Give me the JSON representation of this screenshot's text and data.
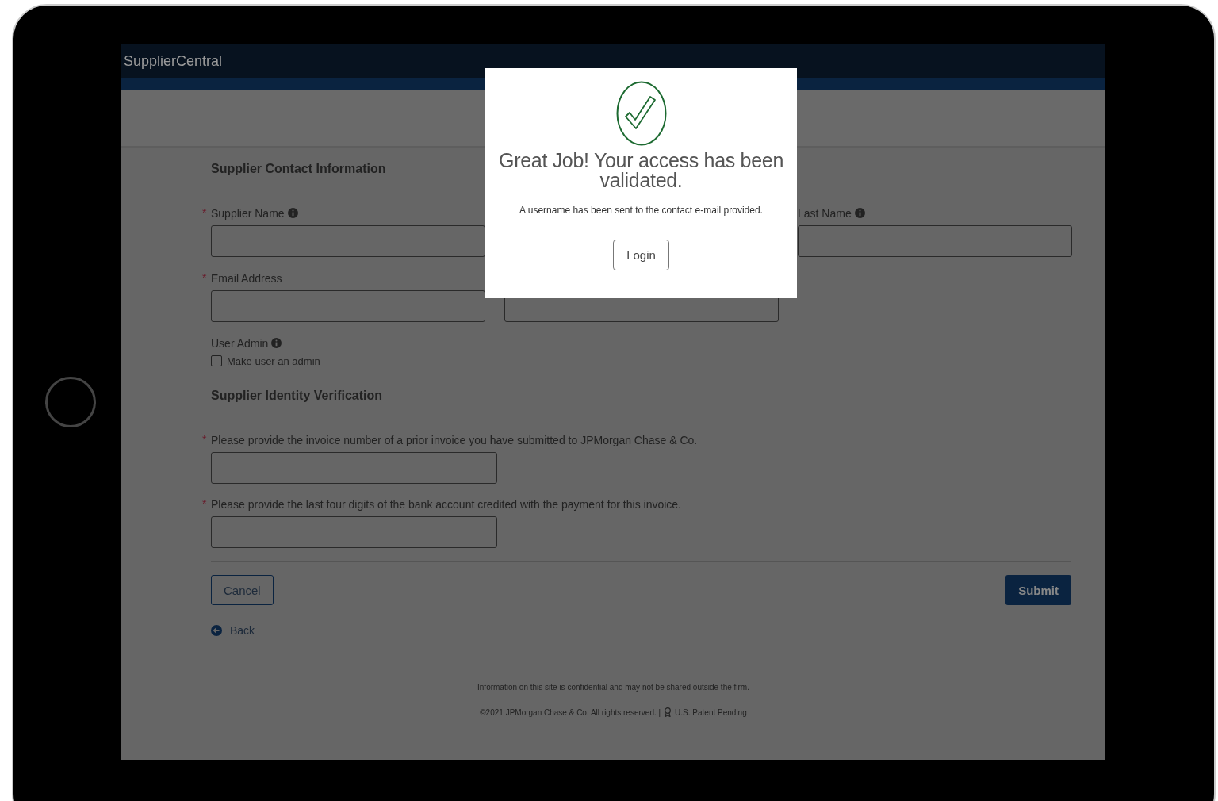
{
  "header": {
    "title": "SupplierCentral"
  },
  "contact_section": {
    "title": "Supplier Contact Information",
    "rows": [
      [
        {
          "kind": "labeled",
          "marker": "*",
          "label": "Supplier Name",
          "info": true
        },
        {
          "kind": "covered"
        },
        {
          "kind": "labeled",
          "label": "Last Name",
          "info": true
        }
      ],
      [
        {
          "kind": "labeled",
          "marker": "*",
          "label": "Email Address",
          "info": false
        },
        {
          "kind": "input"
        }
      ]
    ],
    "user_admin": {
      "label": "User Admin",
      "info": true,
      "checkbox_label": "Make user an admin",
      "checked": false
    }
  },
  "identity_section": {
    "title": "Supplier Identity Verification",
    "questions": [
      {
        "marker": "*",
        "label": "Please provide the invoice number of a prior invoice you have submitted to JPMorgan Chase & Co."
      },
      {
        "marker": "*",
        "label": "Please provide the last four digits of the bank account credited with the payment for this invoice."
      }
    ]
  },
  "actions": {
    "cancel": "Cancel",
    "submit": "Submit",
    "back": "Back"
  },
  "footer": {
    "notice": "Information on this site is confidential and may not be shared outside the firm.",
    "copyright": "©2021 JPMorgan Chase & Co. All rights reserved. |",
    "patent": "U.S. Patent Pending"
  },
  "dialog": {
    "title": "Great Job! Your access has been validated.",
    "message": "A username has been sent to the contact e-mail provided.",
    "button": "Login"
  }
}
